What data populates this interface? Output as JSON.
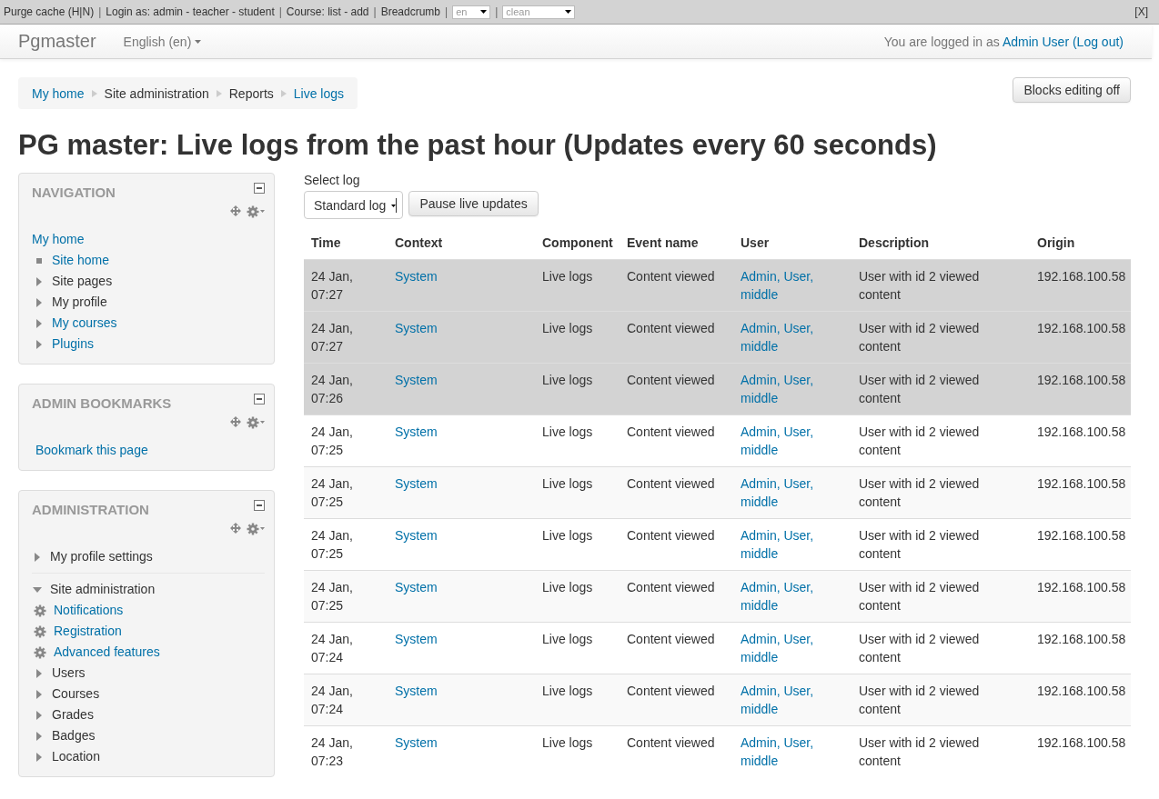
{
  "dev_bar": {
    "items": [
      "Purge cache (H|N)",
      "Login as: admin - teacher - student",
      "Course: list - add",
      "Breadcrumb"
    ],
    "separator": "|",
    "selects": [
      "en",
      "clean"
    ],
    "close": "[X]"
  },
  "navbar": {
    "brand": "Pgmaster",
    "language": "English (en)",
    "login_prefix": "You are logged in as",
    "user": "Admin User",
    "logout": "(Log out)"
  },
  "breadcrumb": [
    {
      "label": "My home",
      "link": true
    },
    {
      "label": "Site administration",
      "link": false
    },
    {
      "label": "Reports",
      "link": false
    },
    {
      "label": "Live logs",
      "link": true
    }
  ],
  "editing_button": "Blocks editing off",
  "heading": "PG master: Live logs from the past hour (Updates every 60 seconds)",
  "blocks": [
    {
      "title": "NAVIGATION",
      "items": [
        {
          "label": "My home",
          "kind": "root",
          "link": true,
          "children": [
            {
              "label": "Site home",
              "kind": "leaf",
              "link": true
            },
            {
              "label": "Site pages",
              "kind": "branch",
              "link": false,
              "expanded": false
            },
            {
              "label": "My profile",
              "kind": "branch",
              "link": false,
              "expanded": false
            },
            {
              "label": "My courses",
              "kind": "branch",
              "link": true,
              "expanded": false
            },
            {
              "label": "Plugins",
              "kind": "branch",
              "link": true,
              "expanded": false
            }
          ]
        }
      ]
    },
    {
      "title": "ADMIN BOOKMARKS",
      "items": [
        {
          "label": "Bookmark this page",
          "kind": "plain",
          "link": true
        }
      ]
    },
    {
      "title": "ADMINISTRATION",
      "items": [
        {
          "label": "My profile settings",
          "kind": "branch",
          "link": false,
          "expanded": false
        },
        {
          "label": "Site administration",
          "kind": "branch",
          "link": false,
          "expanded": true,
          "children": [
            {
              "label": "Notifications",
              "kind": "setting",
              "link": true
            },
            {
              "label": "Registration",
              "kind": "setting",
              "link": true
            },
            {
              "label": "Advanced features",
              "kind": "setting",
              "link": true
            },
            {
              "label": "Users",
              "kind": "branch",
              "link": false,
              "expanded": false
            },
            {
              "label": "Courses",
              "kind": "branch",
              "link": false,
              "expanded": false
            },
            {
              "label": "Grades",
              "kind": "branch",
              "link": false,
              "expanded": false
            },
            {
              "label": "Badges",
              "kind": "branch",
              "link": false,
              "expanded": false
            },
            {
              "label": "Location",
              "kind": "branch",
              "link": false,
              "expanded": false
            }
          ]
        }
      ]
    }
  ],
  "log_select": {
    "label": "Select log",
    "value": "Standard log"
  },
  "pause_button": "Pause live updates",
  "table": {
    "columns": [
      "Time",
      "Context",
      "Component",
      "Event name",
      "User",
      "Description",
      "Origin"
    ],
    "rows": [
      {
        "new": true,
        "cells": [
          "24 Jan, 07:27",
          "System",
          "Live logs",
          "Content viewed",
          "Admin, User, middle",
          "User with id 2 viewed content",
          "192.168.100.58"
        ]
      },
      {
        "new": true,
        "cells": [
          "24 Jan, 07:27",
          "System",
          "Live logs",
          "Content viewed",
          "Admin, User, middle",
          "User with id 2 viewed content",
          "192.168.100.58"
        ]
      },
      {
        "new": true,
        "cells": [
          "24 Jan, 07:26",
          "System",
          "Live logs",
          "Content viewed",
          "Admin, User, middle",
          "User with id 2 viewed content",
          "192.168.100.58"
        ]
      },
      {
        "new": false,
        "cells": [
          "24 Jan, 07:25",
          "System",
          "Live logs",
          "Content viewed",
          "Admin, User, middle",
          "User with id 2 viewed content",
          "192.168.100.58"
        ]
      },
      {
        "new": false,
        "cells": [
          "24 Jan, 07:25",
          "System",
          "Live logs",
          "Content viewed",
          "Admin, User, middle",
          "User with id 2 viewed content",
          "192.168.100.58"
        ]
      },
      {
        "new": false,
        "cells": [
          "24 Jan, 07:25",
          "System",
          "Live logs",
          "Content viewed",
          "Admin, User, middle",
          "User with id 2 viewed content",
          "192.168.100.58"
        ]
      },
      {
        "new": false,
        "cells": [
          "24 Jan, 07:25",
          "System",
          "Live logs",
          "Content viewed",
          "Admin, User, middle",
          "User with id 2 viewed content",
          "192.168.100.58"
        ]
      },
      {
        "new": false,
        "cells": [
          "24 Jan, 07:24",
          "System",
          "Live logs",
          "Content viewed",
          "Admin, User, middle",
          "User with id 2 viewed content",
          "192.168.100.58"
        ]
      },
      {
        "new": false,
        "cells": [
          "24 Jan, 07:24",
          "System",
          "Live logs",
          "Content viewed",
          "Admin, User, middle",
          "User with id 2 viewed content",
          "192.168.100.58"
        ]
      },
      {
        "new": false,
        "cells": [
          "24 Jan, 07:23",
          "System",
          "Live logs",
          "Content viewed",
          "Admin, User, middle",
          "User with id 2 viewed content",
          "192.168.100.58"
        ]
      }
    ]
  }
}
